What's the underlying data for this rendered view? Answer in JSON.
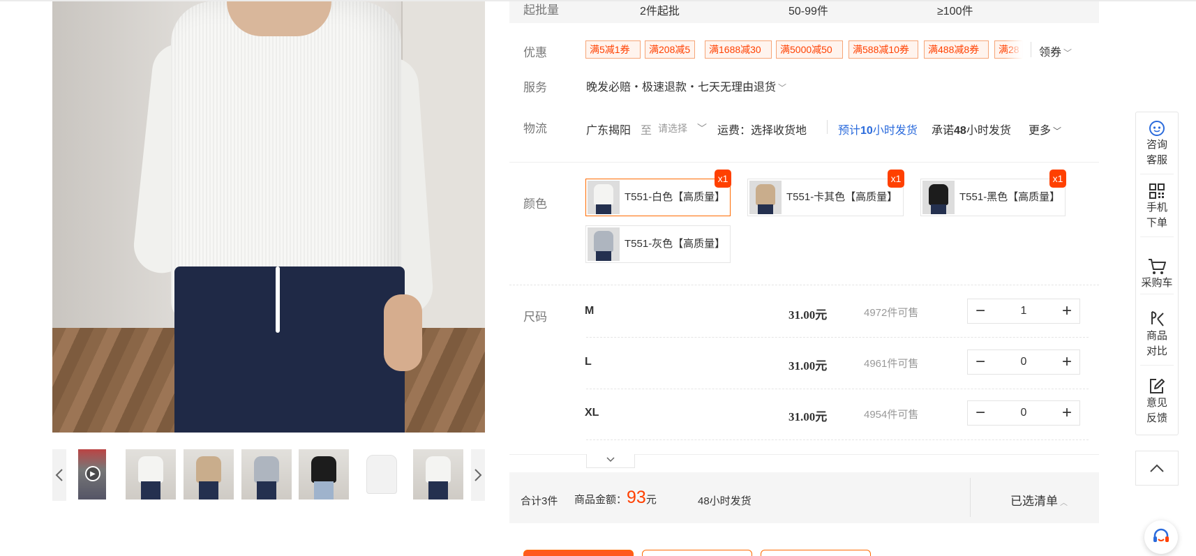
{
  "moq": {
    "label": "起批量",
    "tiers": [
      "2件起批",
      "50-99件",
      "≥100件"
    ]
  },
  "discount": {
    "label": "优惠",
    "coupons": [
      "满5减1券",
      "满208减5",
      "满1688减30",
      "满5000减50",
      "满588减10券",
      "满488减8券",
      "满28"
    ],
    "claim_label": "领券"
  },
  "service": {
    "label": "服务",
    "text": "晚发必赔・极速退款・七天无理由退货"
  },
  "logistics": {
    "label": "物流",
    "origin": "广东揭阳",
    "to": "至",
    "select_placeholder": "请选择",
    "shipping_fee": "运费：选择收货地",
    "estimate_prefix": "预计",
    "estimate_hours": "10",
    "estimate_suffix": "小时发货",
    "promise_prefix": "承诺",
    "promise_hours": "48",
    "promise_suffix": "小时发货",
    "more": "更多"
  },
  "color": {
    "label": "颜色",
    "options": [
      {
        "name": "T551-白色【高质量】",
        "badge": "x1",
        "selected": true,
        "swatch": "#f4f4f2"
      },
      {
        "name": "T551-卡其色【高质量】",
        "badge": "x1",
        "selected": false,
        "swatch": "#c9ad8c"
      },
      {
        "name": "T551-黑色【高质量】",
        "badge": "x1",
        "selected": false,
        "swatch": "#1c1c1c"
      },
      {
        "name": "T551-灰色【高质量】",
        "badge": "",
        "selected": false,
        "swatch": "#aeb5bf"
      }
    ]
  },
  "size": {
    "label": "尺码",
    "rows": [
      {
        "name": "M",
        "price": "31.00元",
        "stock": "4972件可售",
        "qty": "1"
      },
      {
        "name": "L",
        "price": "31.00元",
        "stock": "4961件可售",
        "qty": "0"
      },
      {
        "name": "XL",
        "price": "31.00元",
        "stock": "4954件可售",
        "qty": "0"
      }
    ],
    "expand_icon": "chevron-down-icon"
  },
  "summary": {
    "total_count": "合计3件",
    "amount_label": "商品金额：",
    "amount": "93",
    "amount_unit": "元",
    "ship_text": "48小时发货",
    "selected_list": "已选清单"
  },
  "sidebar": {
    "items": [
      {
        "icon": "chat-bot-icon",
        "line1": "咨询",
        "line2": "客服"
      },
      {
        "icon": "qr-code-icon",
        "line1": "手机",
        "line2": "下单"
      },
      {
        "icon": "cart-icon",
        "line1": "采购车",
        "line2": ""
      },
      {
        "icon": "compare-icon",
        "line1": "商品",
        "line2": "对比"
      },
      {
        "icon": "edit-icon",
        "line1": "意见",
        "line2": "反馈"
      }
    ],
    "to_top_icon": "chevron-up-icon",
    "service_icon": "headset-icon"
  },
  "gallery": {
    "thumbnails": [
      "video",
      "white",
      "khaki",
      "gray",
      "black",
      "white-flat",
      "white-alt"
    ],
    "prev_icon": "chevron-left-icon",
    "next_icon": "chevron-right-icon"
  },
  "colors": {
    "accent": "#ff4000",
    "accent_border": "#ff6a00",
    "link_blue": "#2b6bdc",
    "panel_bg": "#f5f5f5"
  }
}
